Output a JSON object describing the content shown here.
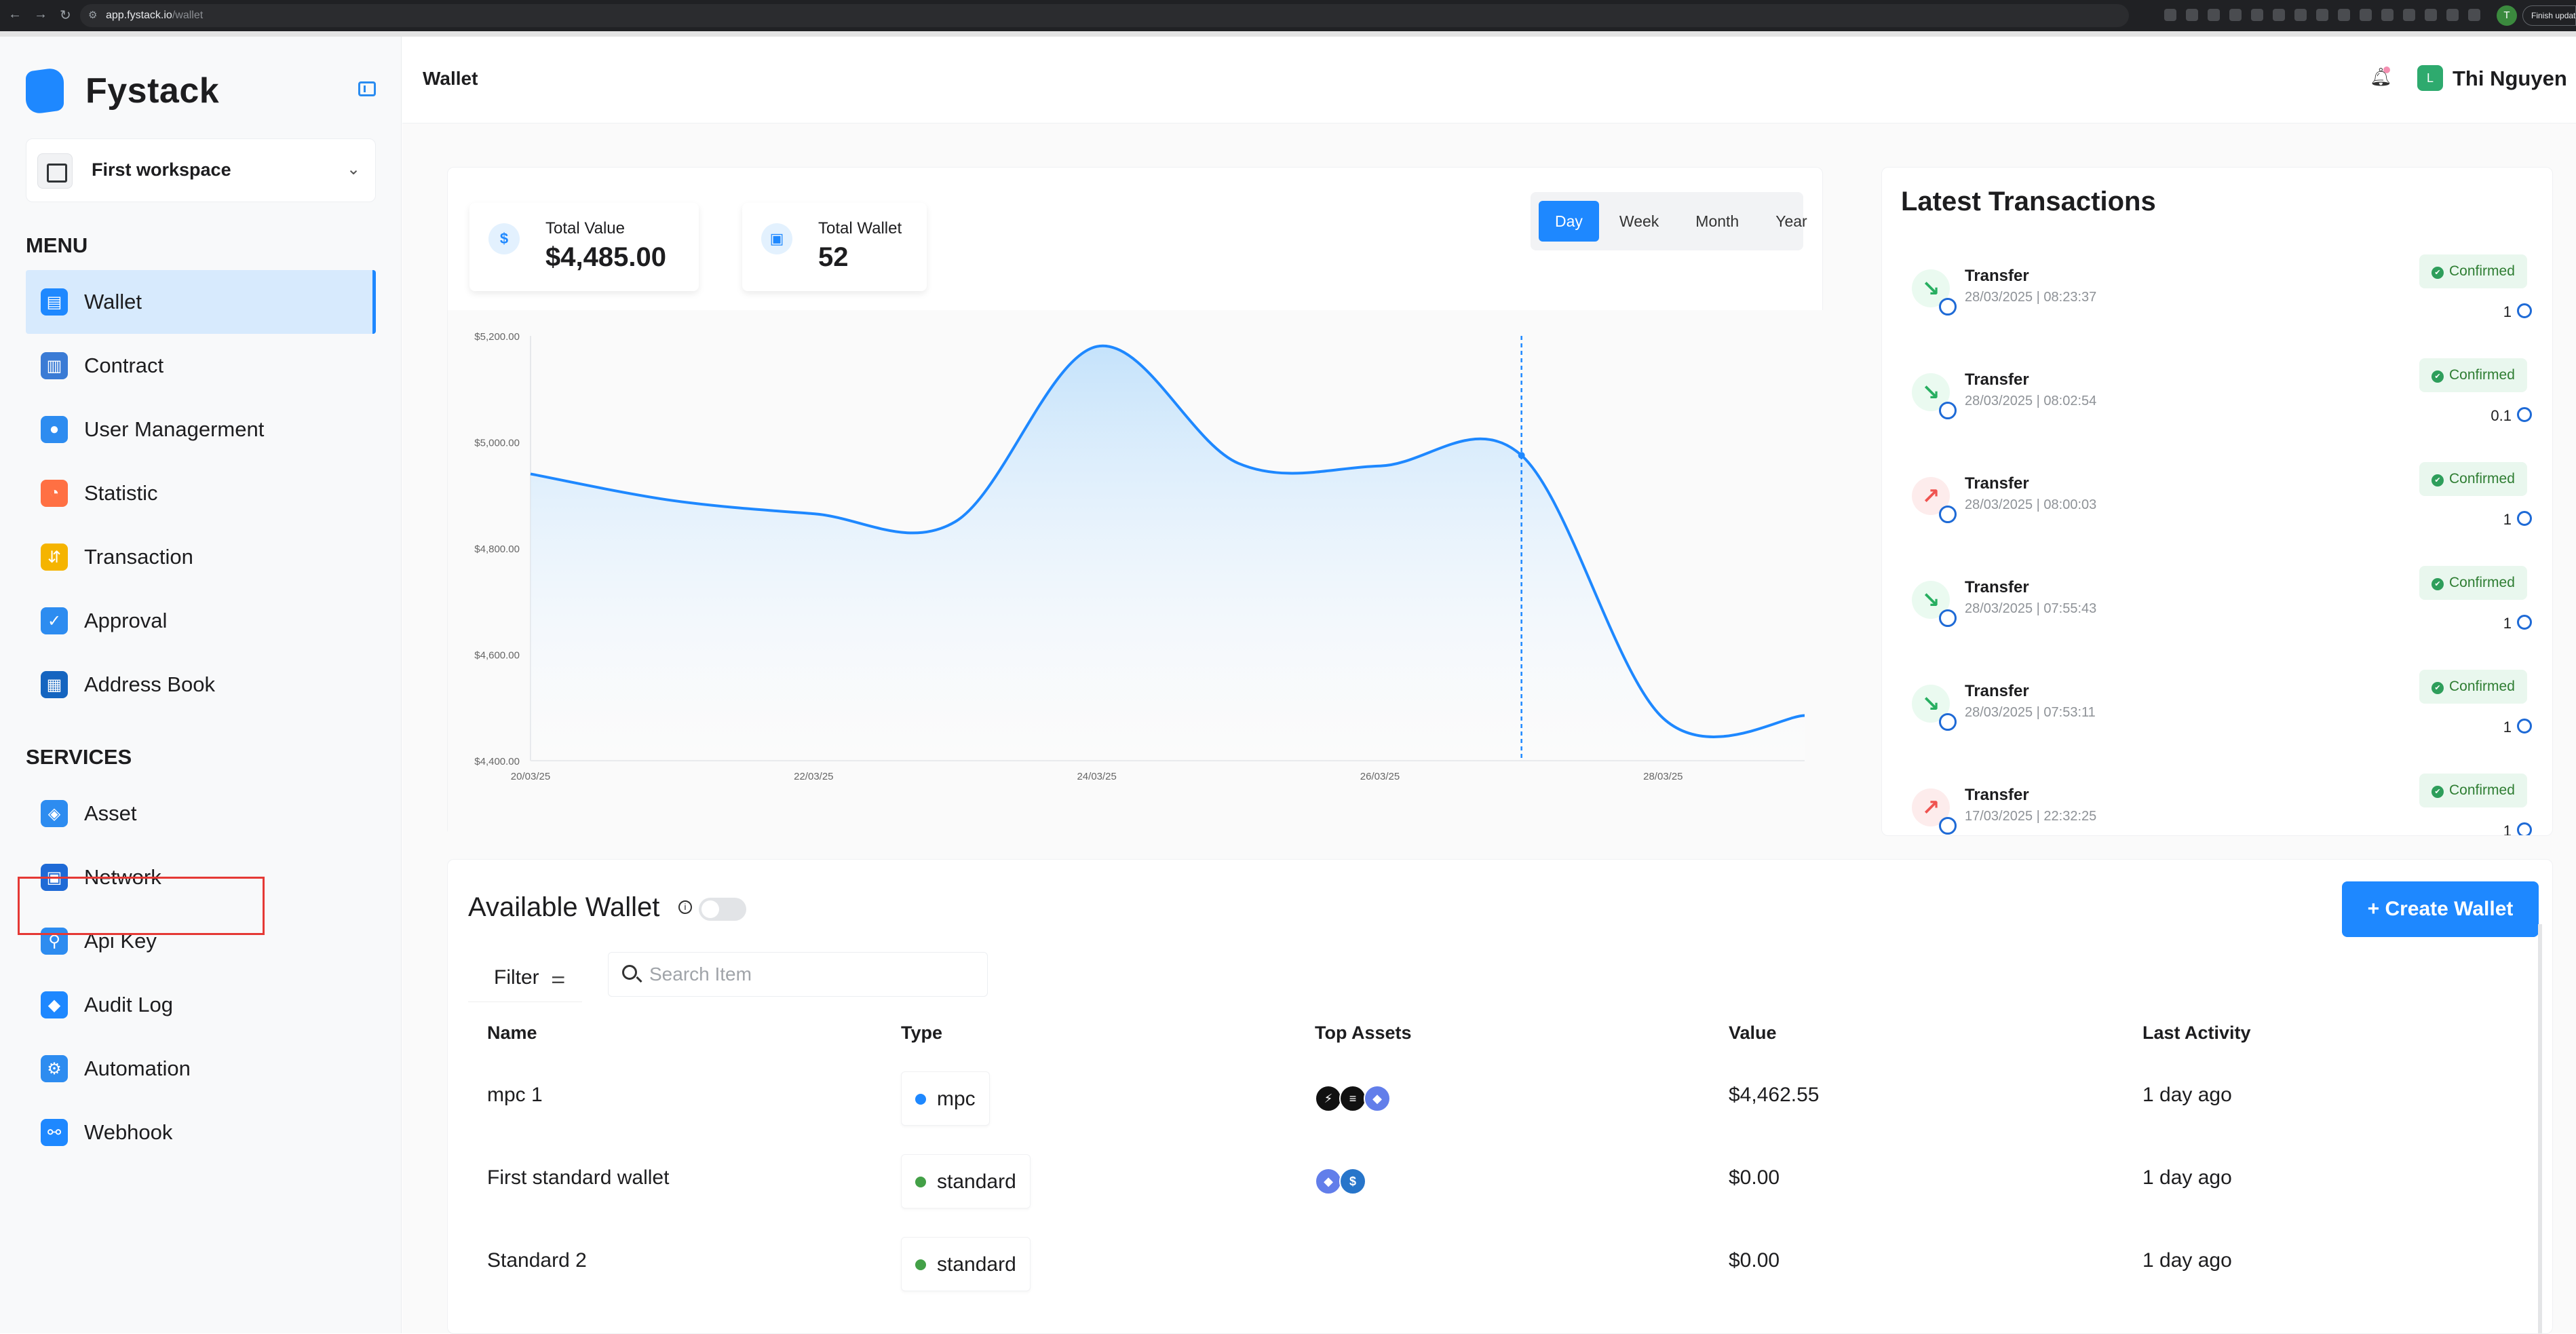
{
  "browser": {
    "url_host": "app.fystack.io",
    "url_path": "/wallet",
    "finish_label": "Finish update"
  },
  "sidebar": {
    "brand": "Fystack",
    "workspace": "First workspace",
    "menu_title": "MENU",
    "menu_items": [
      {
        "label": "Wallet",
        "icon": "wallet-icon",
        "color": "#1e88ff"
      },
      {
        "label": "Contract",
        "icon": "contract-icon",
        "color": "#3a7bd5"
      },
      {
        "label": "User Managerment",
        "icon": "user-icon",
        "color": "#2d8cf0"
      },
      {
        "label": "Statistic",
        "icon": "pie-chart-icon",
        "color": "#ff7043"
      },
      {
        "label": "Transaction",
        "icon": "transaction-icon",
        "color": "#f5b400"
      },
      {
        "label": "Approval",
        "icon": "approval-icon",
        "color": "#2d8cf0"
      },
      {
        "label": "Address Book",
        "icon": "address-book-icon",
        "color": "#1565c0"
      }
    ],
    "services_title": "SERVICES",
    "service_items": [
      {
        "label": "Asset",
        "icon": "asset-icon",
        "color": "#2d8cf0"
      },
      {
        "label": "Network",
        "icon": "network-icon",
        "color": "#1e6ad6"
      },
      {
        "label": "Api Key",
        "icon": "api-key-icon",
        "color": "#2d8cf0"
      },
      {
        "label": "Audit Log",
        "icon": "audit-log-icon",
        "color": "#1e88ff"
      },
      {
        "label": "Automation",
        "icon": "automation-icon",
        "color": "#2d8cf0"
      },
      {
        "label": "Webhook",
        "icon": "webhook-icon",
        "color": "#1e88ff"
      }
    ]
  },
  "header": {
    "title": "Wallet",
    "user_initial": "L",
    "user_name": "Thi Nguyen"
  },
  "stats": {
    "total_value_label": "Total Value",
    "total_value": "$4,485.00",
    "total_wallet_label": "Total Wallet",
    "total_wallet": "52"
  },
  "range": {
    "options": [
      "Day",
      "Week",
      "Month",
      "Year"
    ],
    "selected": "Day"
  },
  "chart_data": {
    "type": "area",
    "x": [
      "20/03/25",
      "21/03/25",
      "22/03/25",
      "23/03/25",
      "24/03/25",
      "25/03/25",
      "26/03/25",
      "27/03/25",
      "28/03/25",
      "29/03/25"
    ],
    "xticks": [
      "20/03/25",
      "22/03/25",
      "24/03/25",
      "26/03/25",
      "28/03/25"
    ],
    "values": [
      4940,
      4890,
      4865,
      4850,
      5180,
      4960,
      4955,
      4975,
      4480,
      4485
    ],
    "yticks": [
      "$5,200.00",
      "$5,000.00",
      "$4,800.00",
      "$4,600.00",
      "$4,400.00"
    ],
    "ylim": [
      4400,
      5200
    ],
    "highlight_x": "27/03/25",
    "color": "#1e88ff"
  },
  "transactions": {
    "title": "Latest Transactions",
    "items": [
      {
        "type": "Transfer",
        "time": "28/03/2025 | 08:23:37",
        "status": "Confirmed",
        "amount": "1",
        "direction": "in"
      },
      {
        "type": "Transfer",
        "time": "28/03/2025 | 08:02:54",
        "status": "Confirmed",
        "amount": "0.1",
        "direction": "in"
      },
      {
        "type": "Transfer",
        "time": "28/03/2025 | 08:00:03",
        "status": "Confirmed",
        "amount": "1",
        "direction": "out"
      },
      {
        "type": "Transfer",
        "time": "28/03/2025 | 07:55:43",
        "status": "Confirmed",
        "amount": "1",
        "direction": "in"
      },
      {
        "type": "Transfer",
        "time": "28/03/2025 | 07:53:11",
        "status": "Confirmed",
        "amount": "1",
        "direction": "in"
      },
      {
        "type": "Transfer",
        "time": "17/03/2025 | 22:32:25",
        "status": "Confirmed",
        "amount": "1",
        "direction": "out"
      }
    ]
  },
  "wallets": {
    "title": "Available Wallet",
    "create_label": "+ Create Wallet",
    "filter_label": "Filter",
    "search_placeholder": "Search Item",
    "columns": [
      "Name",
      "Type",
      "Top Assets",
      "Value",
      "Last Activity"
    ],
    "rows": [
      {
        "name": "mpc 1",
        "type": "mpc",
        "type_color": "#1e88ff",
        "assets": [
          "zap",
          "solana",
          "ethereum"
        ],
        "value": "$4,462.55",
        "last": "1 day ago"
      },
      {
        "name": "First standard wallet",
        "type": "standard",
        "type_color": "#43a047",
        "assets": [
          "ethereum",
          "usdc"
        ],
        "value": "$0.00",
        "last": "1 day ago"
      },
      {
        "name": "Standard 2",
        "type": "standard",
        "type_color": "#43a047",
        "assets": [],
        "value": "$0.00",
        "last": "1 day ago"
      }
    ]
  }
}
